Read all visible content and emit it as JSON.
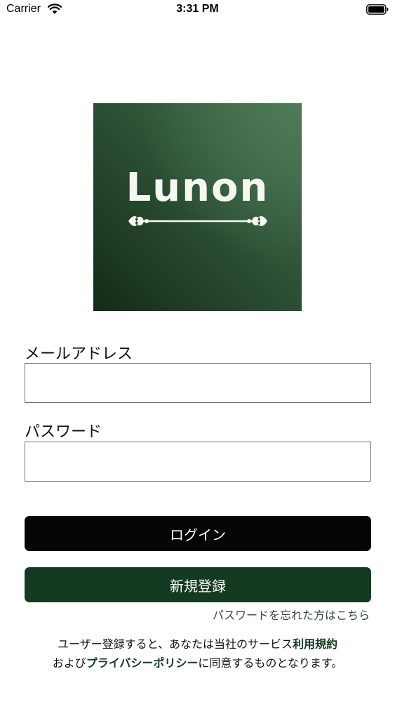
{
  "status_bar": {
    "carrier": "Carrier",
    "time": "3:31 PM",
    "icons": [
      "wifi-icon",
      "battery-icon"
    ]
  },
  "logo": {
    "text": "Lunon",
    "icon": "ornament-arrow-icon",
    "colors": {
      "background_dark": "#132b14",
      "background_light": "#4f7a57",
      "foreground": "#f7f7f2"
    }
  },
  "form": {
    "email_label": "メールアドレス",
    "email_value": "",
    "password_label": "パスワード",
    "password_value": ""
  },
  "buttons": {
    "login_label": "ログイン",
    "register_label": "新規登録"
  },
  "colors": {
    "login_button": "#050505",
    "register_button": "#143a22",
    "link_accent": "#143a22"
  },
  "forgot_password": "パスワードを忘れた方はこちら",
  "terms": {
    "line1_prefix": "ユーザー登録すると、あなたは当社のサービス",
    "terms_link": "利用規約",
    "line2_prefix": "および",
    "privacy_link": "プライバシーポリシー",
    "line2_suffix": "に同意するものとなります。"
  }
}
